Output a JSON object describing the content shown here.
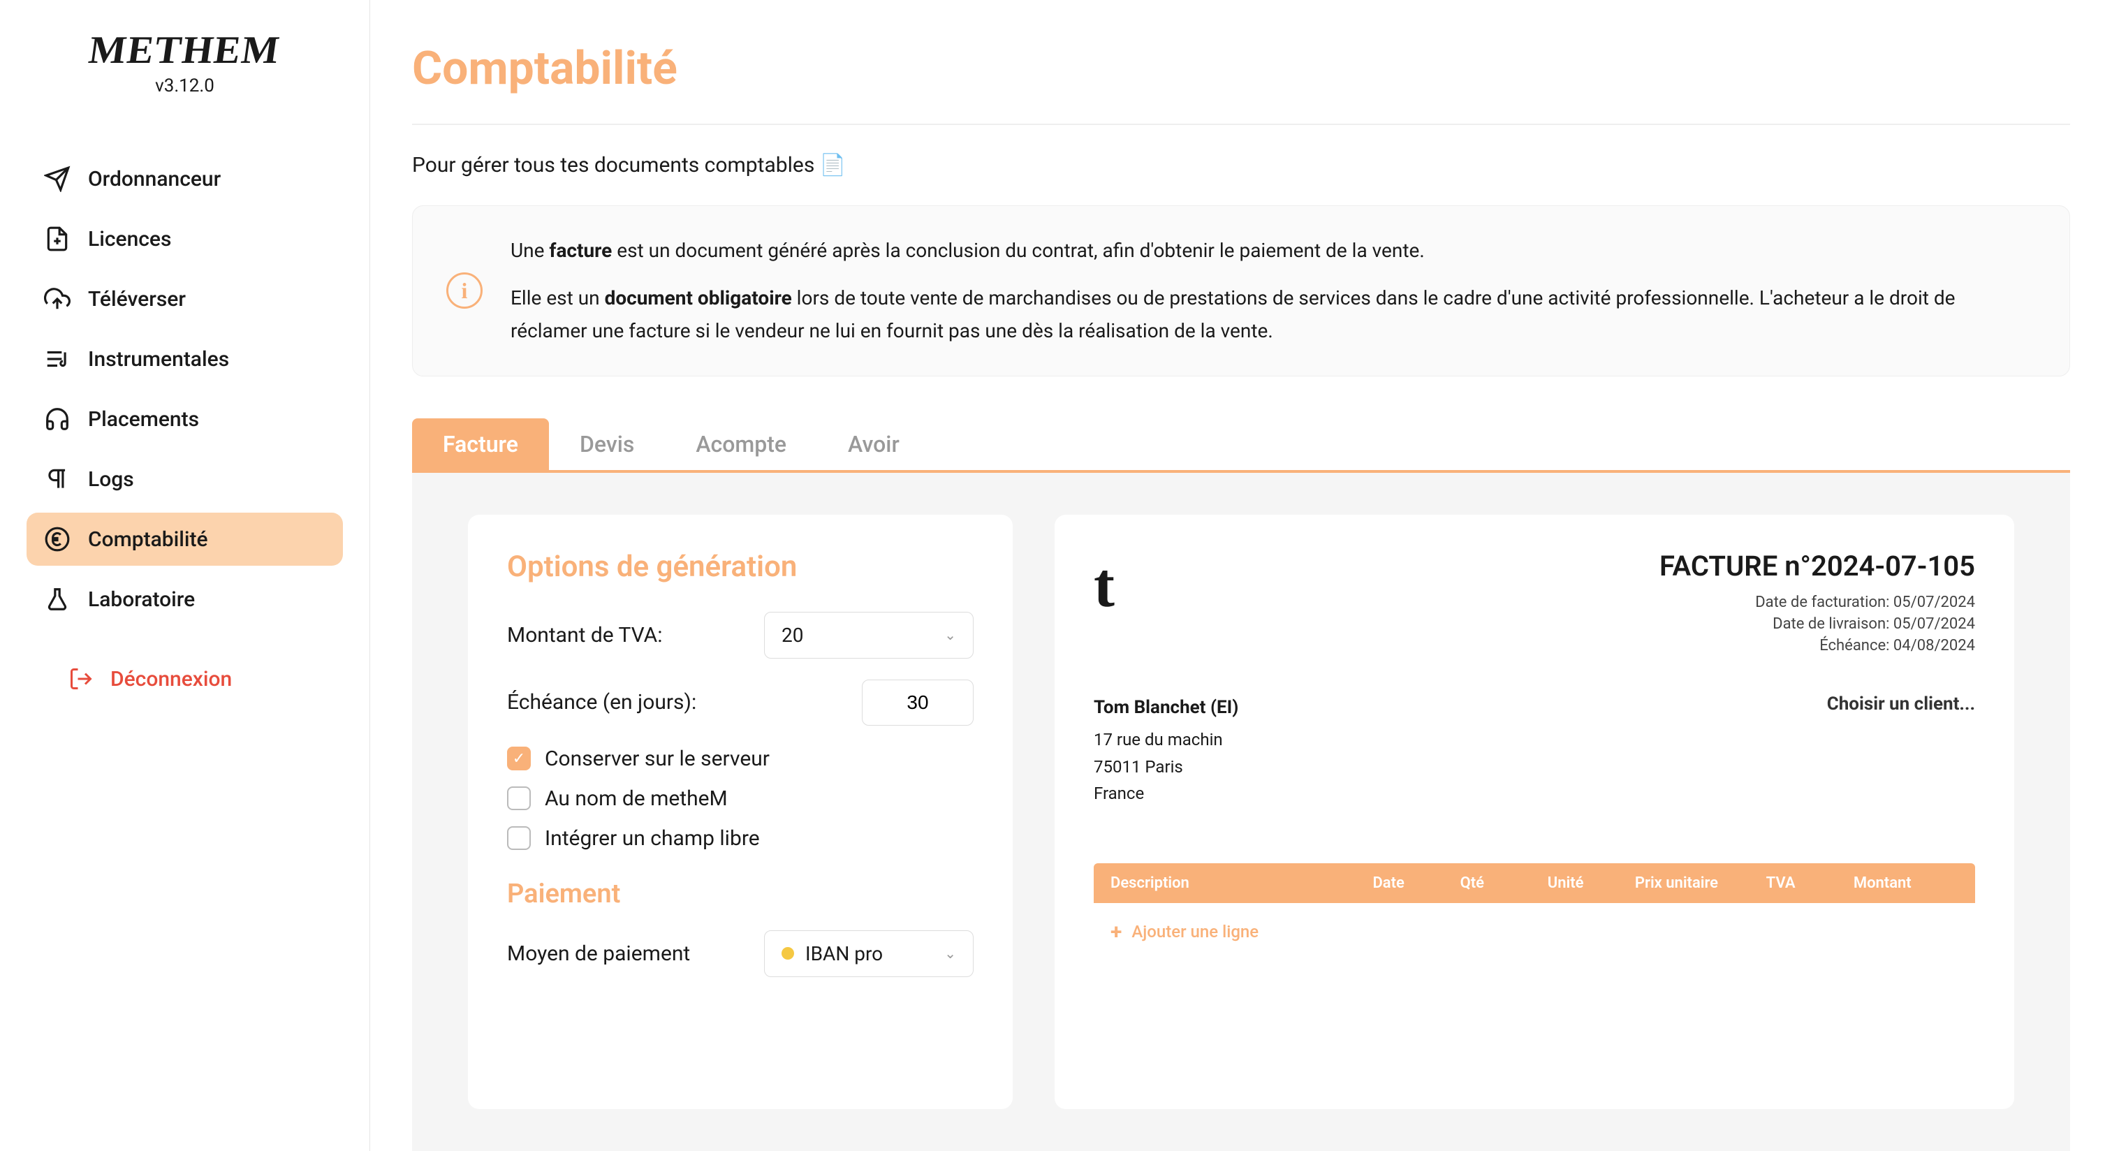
{
  "app": {
    "name": "METHEM",
    "version": "v3.12.0"
  },
  "sidebar": {
    "items": [
      {
        "label": "Ordonnanceur"
      },
      {
        "label": "Licences"
      },
      {
        "label": "Téléverser"
      },
      {
        "label": "Instrumentales"
      },
      {
        "label": "Placements"
      },
      {
        "label": "Logs"
      },
      {
        "label": "Comptabilité"
      },
      {
        "label": "Laboratoire"
      }
    ],
    "logout": "Déconnexion"
  },
  "page": {
    "title": "Comptabilité",
    "subtitle": "Pour gérer tous tes documents comptables 📄"
  },
  "info": {
    "p1a": "Une ",
    "p1b": "facture",
    "p1c": " est un document généré après la conclusion du contrat, afin d'obtenir le paiement de la vente.",
    "p2a": "Elle est un ",
    "p2b": "document obligatoire",
    "p2c": " lors de toute vente de marchandises ou de prestations de services dans le cadre d'une activité professionnelle. L'acheteur a le droit de réclamer une facture si le vendeur ne lui en fournit pas une dès la réalisation de la vente."
  },
  "tabs": [
    "Facture",
    "Devis",
    "Acompte",
    "Avoir"
  ],
  "options": {
    "title": "Options de génération",
    "tva_label": "Montant de TVA:",
    "tva_value": "20",
    "due_label": "Échéance (en jours):",
    "due_value": "30",
    "check1": "Conserver sur le serveur",
    "check2": "Au nom de metheM",
    "check3": "Intégrer un champ libre",
    "payment_title": "Paiement",
    "payment_label": "Moyen de paiement",
    "payment_value": "IBAN pro"
  },
  "invoice": {
    "logo": "t",
    "number": "FACTURE n°2024-07-105",
    "date1_label": "Date de facturation: ",
    "date1": "05/07/2024",
    "date2_label": "Date de livraison: ",
    "date2": "05/07/2024",
    "date3_label": "Échéance: ",
    "date3": "04/08/2024",
    "sender": {
      "name": "Tom Blanchet (EI)",
      "line1": "17 rue du machin",
      "line2": "75011 Paris",
      "line3": "France"
    },
    "client_placeholder": "Choisir un client...",
    "columns": [
      "Description",
      "Date",
      "Qté",
      "Unité",
      "Prix unitaire",
      "TVA",
      "Montant"
    ],
    "add_line": "Ajouter une ligne"
  }
}
